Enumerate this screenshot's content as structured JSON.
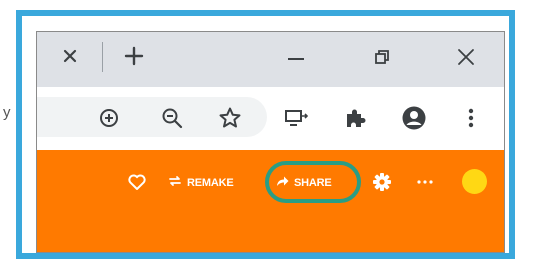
{
  "side_glyph": "y",
  "tabstrip": {
    "close_tab": "close-tab",
    "new_tab": "new-tab"
  },
  "window_controls": [
    "minimize",
    "restore",
    "close"
  ],
  "toolbar": {
    "icons": [
      "zoom-in",
      "zoom-out",
      "bookmark-star",
      "cast",
      "extensions",
      "profile",
      "menu"
    ]
  },
  "appbar": {
    "remake_label": "REMAKE",
    "share_label": "SHARE",
    "avatar_color": "#ffd814",
    "bar_color": "#ff7a00",
    "highlight_color": "#2a9d84"
  },
  "frame_color": "#3aa8dc"
}
